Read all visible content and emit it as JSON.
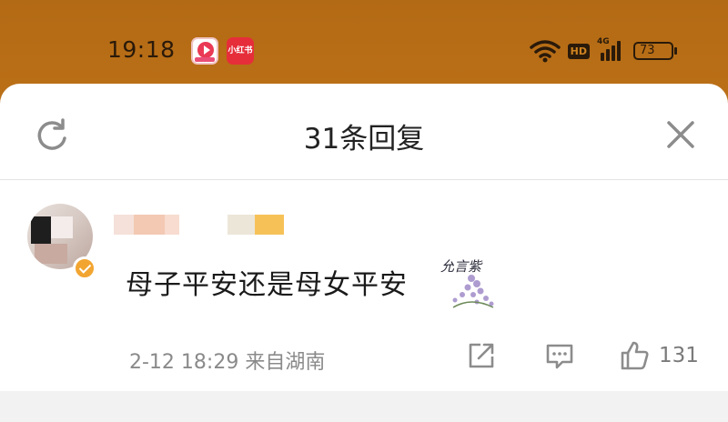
{
  "status_bar": {
    "time": "19:18",
    "app2_label": "小红书",
    "network": "4G",
    "hd_label": "HD",
    "battery": "73"
  },
  "sheet": {
    "title": "31条回复"
  },
  "comment": {
    "text": "母子平安还是母女平安",
    "sticker_text": "允言紫",
    "meta": "2-12 18:29 来自湖南",
    "like_count": "131"
  },
  "icons": [
    "refresh-icon",
    "close-icon",
    "verified-icon",
    "share-icon",
    "reply-icon",
    "like-icon",
    "wifi-icon",
    "signal-icon",
    "battery-icon"
  ],
  "colors": {
    "status_bg": "#c7791c",
    "badge": "#f2a531",
    "meta_gray": "#8a8a8a"
  }
}
